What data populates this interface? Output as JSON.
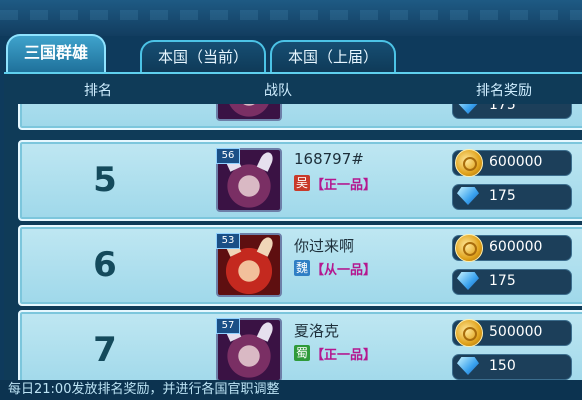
{
  "tabs": [
    {
      "label": "三国群雄",
      "active": true
    },
    {
      "label": "本国（当前）",
      "active": false
    },
    {
      "label": "本国（上届）",
      "active": false
    }
  ],
  "header": {
    "rank": "排名",
    "team": "战队",
    "reward": "排名奖励"
  },
  "rows": [
    {
      "rank": "",
      "level": "",
      "name": "",
      "nation": "",
      "rank_name": "",
      "gold": "",
      "gem": "175"
    },
    {
      "rank": "5",
      "level": "56",
      "name": "168797#",
      "nation": "吴",
      "rank_name": "【正一品】",
      "gold": "600000",
      "gem": "175"
    },
    {
      "rank": "6",
      "level": "53",
      "name": "你过来啊",
      "nation": "魏",
      "rank_name": "【从一品】",
      "gold": "600000",
      "gem": "175"
    },
    {
      "rank": "7",
      "level": "57",
      "name": "夏洛克",
      "nation": "蜀",
      "rank_name": "【正一品】",
      "gold": "500000",
      "gem": "150"
    }
  ],
  "nation_colors": {
    "吴": "#c83a2a",
    "魏": "#2f7ec4",
    "蜀": "#2f9a3a"
  },
  "footer": "每日21:00发放排名奖励，并进行各国官职调整"
}
